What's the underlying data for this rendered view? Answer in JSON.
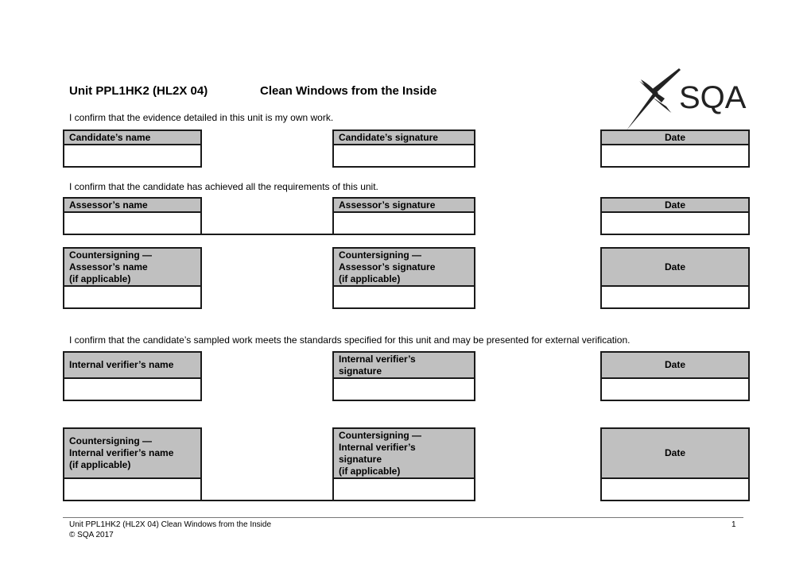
{
  "header": {
    "unit_code": "Unit PPL1HK2 (HL2X 04)",
    "unit_title": "Clean Windows from the Inside",
    "logo_text": "SQA",
    "logo_icon": "sqa-saltire-logo-icon"
  },
  "sections": {
    "candidate": {
      "statement": "I confirm that the evidence detailed in this unit is my own work.",
      "name_label": "Candidate’s name",
      "signature_label": "Candidate’s signature",
      "date_label": "Date",
      "name_value": "",
      "signature_value": "",
      "date_value": ""
    },
    "assessor": {
      "statement": "I confirm that the candidate has achieved all the requirements of this unit.",
      "name_label": "Assessor’s name",
      "signature_label": "Assessor’s signature",
      "date_label": "Date",
      "name_value": "",
      "signature_value": "",
      "date_value": ""
    },
    "countersign_assessor": {
      "name_label": "Countersigning —\nAssessor’s name\n(if applicable)",
      "signature_label": "Countersigning —\nAssessor’s signature\n(if applicable)",
      "date_label": "Date",
      "name_value": "",
      "signature_value": "",
      "date_value": ""
    },
    "internal_verifier": {
      "statement": "I confirm that the candidate’s sampled work meets the standards specified for this unit and may be presented for external verification.",
      "name_label": "Internal verifier’s name",
      "signature_label": "Internal verifier’s\nsignature",
      "date_label": "Date",
      "name_value": "",
      "signature_value": "",
      "date_value": ""
    },
    "countersign_verifier": {
      "name_label": "Countersigning —\nInternal verifier’s name\n(if applicable)",
      "signature_label": "Countersigning —\nInternal verifier’s\nsignature\n(if applicable)",
      "date_label": "Date",
      "name_value": "",
      "signature_value": "",
      "date_value": ""
    }
  },
  "footer": {
    "doc_title": "Unit PPL1HK2 (HL2X 04) Clean Windows from the Inside",
    "copyright": "© SQA 2017",
    "page_number": "1"
  },
  "colors": {
    "header_fill": "#c0c0c0",
    "border": "#1a1a1a"
  }
}
